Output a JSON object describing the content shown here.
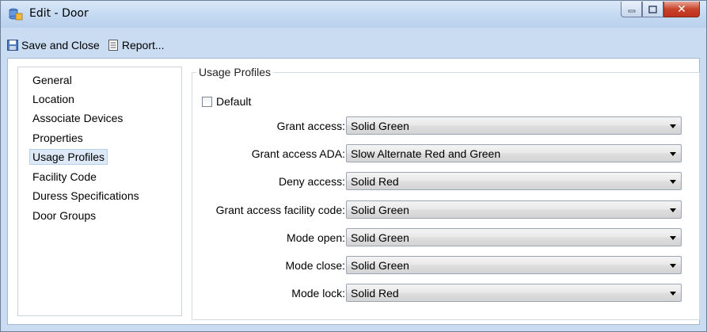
{
  "window": {
    "title": "Edit - Door"
  },
  "toolbar": {
    "save_close": "Save and Close",
    "report": "Report..."
  },
  "nav": {
    "items": [
      {
        "label": "General"
      },
      {
        "label": "Location"
      },
      {
        "label": "Associate Devices"
      },
      {
        "label": "Properties"
      },
      {
        "label": "Usage Profiles",
        "selected": true
      },
      {
        "label": "Facility Code"
      },
      {
        "label": "Duress Specifications"
      },
      {
        "label": "Door Groups"
      }
    ]
  },
  "panel": {
    "title": "Usage Profiles",
    "default_label": "Default",
    "default_checked": false,
    "fields": [
      {
        "label": "Grant access:",
        "value": "Solid Green"
      },
      {
        "label": "Grant access ADA:",
        "value": "Slow Alternate Red and Green"
      },
      {
        "label": "Deny access:",
        "value": "Solid Red"
      },
      {
        "label": "Grant access facility code:",
        "value": "Solid Green"
      },
      {
        "label": "Mode open:",
        "value": "Solid Green"
      },
      {
        "label": "Mode close:",
        "value": "Solid Green"
      },
      {
        "label": "Mode lock:",
        "value": "Solid Red"
      }
    ]
  }
}
